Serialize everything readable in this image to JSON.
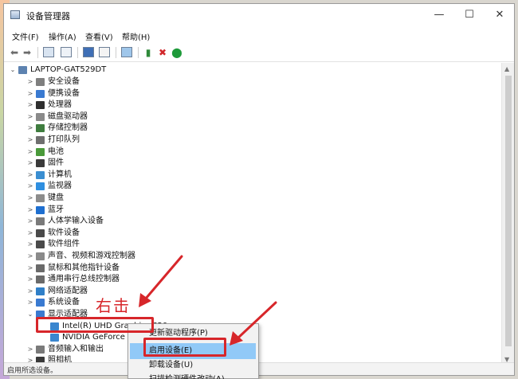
{
  "window": {
    "title": "设备管理器",
    "controls": [
      "—",
      "☐",
      "✕"
    ]
  },
  "menubar": [
    "文件(F)",
    "操作(A)",
    "查看(V)",
    "帮助(H)"
  ],
  "toolbar": [
    "back",
    "forward",
    "properties",
    "show-hidden",
    "help",
    "view",
    "scan",
    "enable",
    "uninstall",
    "update"
  ],
  "tree": {
    "root": "LAPTOP-GAT529DT",
    "categories": [
      {
        "label": "安全设备",
        "color": "#7f7f7f"
      },
      {
        "label": "便携设备",
        "color": "#3a7ad1"
      },
      {
        "label": "处理器",
        "color": "#2f2f2f"
      },
      {
        "label": "磁盘驱动器",
        "color": "#8a8a8a"
      },
      {
        "label": "存储控制器",
        "color": "#3f7d3f"
      },
      {
        "label": "打印队列",
        "color": "#6f6f6f"
      },
      {
        "label": "电池",
        "color": "#4a9a3a"
      },
      {
        "label": "固件",
        "color": "#3a3a3a"
      },
      {
        "label": "计算机",
        "color": "#3a8ed1"
      },
      {
        "label": "监视器",
        "color": "#2f8fe0"
      },
      {
        "label": "键盘",
        "color": "#8c8c8c"
      },
      {
        "label": "蓝牙",
        "color": "#1e6fd0"
      },
      {
        "label": "人体学输入设备",
        "color": "#7a7a7a"
      },
      {
        "label": "软件设备",
        "color": "#4a4a4a"
      },
      {
        "label": "软件组件",
        "color": "#4a4a4a"
      },
      {
        "label": "声音、视频和游戏控制器",
        "color": "#8a8a8a"
      },
      {
        "label": "鼠标和其他指针设备",
        "color": "#6a6a6a"
      },
      {
        "label": "通用串行总线控制器",
        "color": "#6a6a6a"
      },
      {
        "label": "网络适配器",
        "color": "#2f7fc8"
      },
      {
        "label": "系统设备",
        "color": "#3a7ad1"
      },
      {
        "label": "显示适配器",
        "color": "#3a7ad1"
      }
    ],
    "display_children": [
      "Intel(R) UHD Graphics 620",
      "NVIDIA GeForce M"
    ],
    "after": [
      {
        "label": "音频输入和输出",
        "color": "#7a7a7a"
      },
      {
        "label": "照相机",
        "color": "#3a3a3a"
      }
    ]
  },
  "context_menu": {
    "items": [
      "更新驱动程序(P)",
      "启用设备(E)",
      "卸载设备(U)",
      "扫描检测硬件改动(A)"
    ]
  },
  "annotation": {
    "label": "右击"
  },
  "status": "启用所选设备。",
  "colors": {
    "highlight": "#91c9f7",
    "annotation": "#d7262a"
  }
}
